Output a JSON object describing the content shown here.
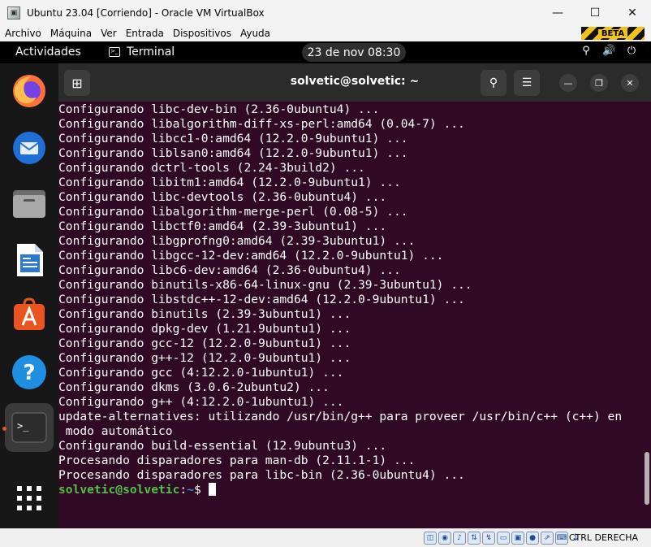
{
  "window": {
    "title": "Ubuntu 23.04 [Corriendo] - Oracle VM VirtualBox",
    "app_icon": "virtualbox-icon",
    "controls": [
      "minimize-icon",
      "maximize-icon",
      "close-icon"
    ]
  },
  "menu": {
    "items": [
      "Archivo",
      "Máquina",
      "Ver",
      "Entrada",
      "Dispositivos",
      "Ayuda"
    ],
    "badge": "BETA"
  },
  "gnome": {
    "activities": "Actividades",
    "app_name": "Terminal",
    "clock": "23 de nov  08:30",
    "system_icons": [
      "network-icon",
      "volume-icon",
      "power-icon"
    ]
  },
  "dock": {
    "items": [
      {
        "name": "firefox",
        "icon": "firefox-icon",
        "color": "#ff7139"
      },
      {
        "name": "thunderbird",
        "icon": "thunderbird-icon",
        "color": "#1f6fd6"
      },
      {
        "name": "files",
        "icon": "files-icon",
        "color": "#8a8a8a"
      },
      {
        "name": "writer",
        "icon": "libreoffice-writer-icon",
        "color": "#2a7ad1"
      },
      {
        "name": "app-center",
        "icon": "app-center-icon",
        "color": "#e95420"
      },
      {
        "name": "help",
        "icon": "help-icon",
        "color": "#1e8fe1"
      },
      {
        "name": "terminal",
        "icon": "terminal-icon",
        "color": "#2c2c2c"
      },
      {
        "name": "show-apps",
        "icon": "apps-grid-icon",
        "color": "#ffffff"
      }
    ]
  },
  "terminal": {
    "title": "solvetic@solvetic: ~",
    "lines": [
      "Configurando libc-dev-bin (2.36-0ubuntu4) ...",
      "Configurando libalgorithm-diff-xs-perl:amd64 (0.04-7) ...",
      "Configurando libcc1-0:amd64 (12.2.0-9ubuntu1) ...",
      "Configurando liblsan0:amd64 (12.2.0-9ubuntu1) ...",
      "Configurando dctrl-tools (2.24-3build2) ...",
      "Configurando libitm1:amd64 (12.2.0-9ubuntu1) ...",
      "Configurando libc-devtools (2.36-0ubuntu4) ...",
      "Configurando libalgorithm-merge-perl (0.08-5) ...",
      "Configurando libctf0:amd64 (2.39-3ubuntu1) ...",
      "Configurando libgprofng0:amd64 (2.39-3ubuntu1) ...",
      "Configurando libgcc-12-dev:amd64 (12.2.0-9ubuntu1) ...",
      "Configurando libc6-dev:amd64 (2.36-0ubuntu4) ...",
      "Configurando binutils-x86-64-linux-gnu (2.39-3ubuntu1) ...",
      "Configurando libstdc++-12-dev:amd64 (12.2.0-9ubuntu1) ...",
      "Configurando binutils (2.39-3ubuntu1) ...",
      "Configurando dpkg-dev (1.21.9ubuntu1) ...",
      "Configurando gcc-12 (12.2.0-9ubuntu1) ...",
      "Configurando g++-12 (12.2.0-9ubuntu1) ...",
      "Configurando gcc (4:12.2.0-1ubuntu1) ...",
      "Configurando dkms (3.0.6-2ubuntu2) ...",
      "Configurando g++ (4:12.2.0-1ubuntu1) ...",
      "update-alternatives: utilizando /usr/bin/g++ para proveer /usr/bin/c++ (c++) en",
      " modo automático",
      "Configurando build-essential (12.9ubuntu3) ...",
      "Procesando disparadores para man-db (2.11.1-1) ...",
      "Procesando disparadores para libc-bin (2.36-0ubuntu4) ..."
    ],
    "prompt_user": "solvetic@solvetic",
    "prompt_sep": ":",
    "prompt_path": "~",
    "prompt_symbol": "$ "
  },
  "status_bar": {
    "icons": [
      "hdd-icon",
      "optical-disk-icon",
      "audio-icon",
      "network-icon",
      "usb-icon",
      "shared-folder-icon",
      "display-icon",
      "recording-icon",
      "mouse-integration-icon",
      "keyboard-icon"
    ],
    "host_key": "CTRL DERECHA"
  },
  "colors": {
    "terminal_bg": "#300a24",
    "prompt_user": "#4ec542",
    "prompt_path": "#3d87e0",
    "ubuntu_orange": "#e95420"
  }
}
